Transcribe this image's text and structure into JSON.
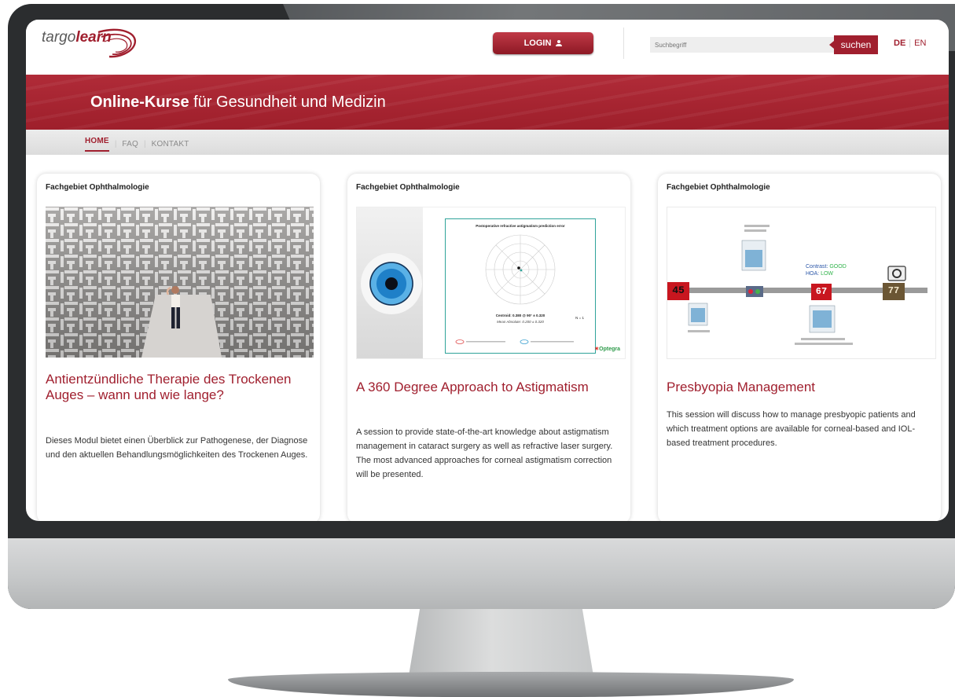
{
  "header": {
    "logo_regular": "targo",
    "logo_bold": "learn",
    "login_label": "LOGIN",
    "search_placeholder": "Suchbegriff",
    "search_button": "suchen",
    "lang_de": "DE",
    "lang_en": "EN"
  },
  "banner": {
    "title_bold": "Online-Kurse",
    "title_rest": " für Gesundheit und Medizin"
  },
  "nav": {
    "items": [
      {
        "label": "HOME"
      },
      {
        "label": "FAQ"
      },
      {
        "label": "KONTAKT"
      }
    ]
  },
  "cards": [
    {
      "category": "Fachgebiet Ophthalmologie",
      "title": "Antientzündliche Therapie des Trockenen Auges – wann und wie lange?",
      "text": "Dieses Modul bietet einen Überblick zur Pathogenese, der Diagnose und den aktuellen Behandlungsmöglichkeiten des Trockenen Auges."
    },
    {
      "category": "Fachgebiet Ophthalmologie",
      "title": "A 360 Degree Approach to Astigmatism",
      "text": "A session to provide state-of-the-art knowledge about astigmatism management in cataract surgery as well as refractive laser surgery. The most advanced approaches for corneal astigmatism correction will be presented.",
      "image": {
        "plot_title": "Postoperative refractive astigmatism prediction error",
        "centroid": "Centroid: 0.380 @ 90° ± 0.320",
        "mean_absolute": "Mean Absolute: 0.200 ± 0.320",
        "n": "N = 1",
        "brand": "Optegra"
      }
    },
    {
      "category": "Fachgebiet Ophthalmologie",
      "title": "Presbyopia Management",
      "text": "This session will discuss how to manage presbyopic patients and which treatment options are available for corneal-based and IOL-based treatment procedures.",
      "image": {
        "age_1": "45",
        "age_2": "67",
        "age_3": "77",
        "contrast_label": "Contrast:",
        "contrast_value": "GOOD",
        "hoa_label": "HOA:",
        "hoa_value": "LOW"
      }
    }
  ],
  "colors": {
    "brand_red": "#a01f2e",
    "nav_text": "#8a8a8a",
    "monitor_frame": "#2b2d2f"
  },
  "icons": {
    "login": "user-icon"
  }
}
